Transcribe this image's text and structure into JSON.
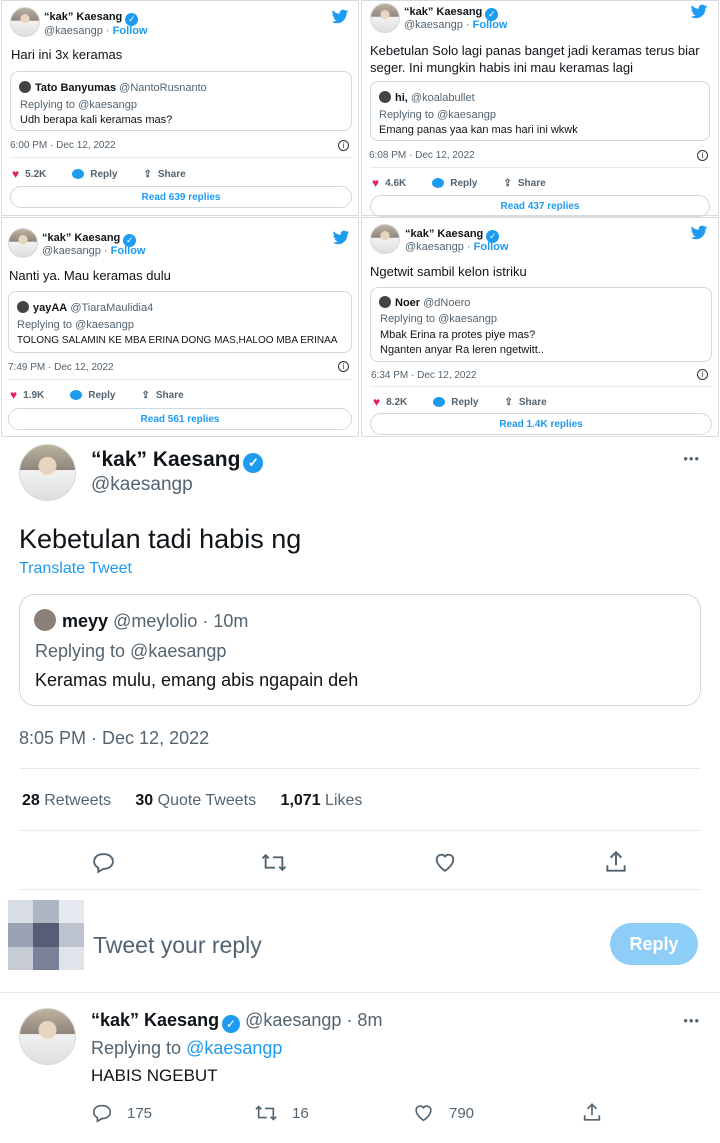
{
  "user": {
    "name": "“kak” Kaesang",
    "handle": "@kaesangp",
    "follow": "Follow"
  },
  "tweets": [
    {
      "text": "Hari ini 3x keramas",
      "quote_name": "Tato Banyumas",
      "quote_handle": "@NantoRusnanto",
      "replying": "Replying to @kaesangp",
      "quote_text": "Udh berapa kali keramas mas?",
      "time": "6:00 PM · Dec 12, 2022",
      "likes": "5.2K",
      "reply": "Reply",
      "share": "Share",
      "replies": "Read 639 replies"
    },
    {
      "text": "Kebetulan Solo lagi panas banget jadi keramas terus biar seger. Ini mungkin habis ini mau keramas lagi",
      "quote_name": "hi,",
      "quote_handle": "@koalabullet",
      "replying": "Replying to @kaesangp",
      "quote_text": "Emang panas yaa kan mas hari ini wkwk",
      "time": "6:08 PM · Dec 12, 2022",
      "likes": "4.6K",
      "reply": "Reply",
      "share": "Share",
      "replies": "Read 437 replies"
    },
    {
      "text": "Nanti ya. Mau keramas dulu",
      "quote_name": "yayAA",
      "quote_handle": "@TiaraMaulidia4",
      "replying": "Replying to @kaesangp",
      "quote_text": "TOLONG SALAMIN KE MBA ERINA DONG MAS,HALOO MBA ERINAA",
      "time": "7:49 PM · Dec 12, 2022",
      "likes": "1.9K",
      "reply": "Reply",
      "share": "Share",
      "replies": "Read 561 replies"
    },
    {
      "text": "Ngetwit sambil kelon istriku",
      "quote_name": "Noer",
      "quote_handle": "@dNoero",
      "replying": "Replying to @kaesangp",
      "quote_text": "Mbak Erina ra protes piye mas?",
      "quote_text2": "Nganten anyar Ra leren ngetwitt..",
      "time": "6:34 PM · Dec 12, 2022",
      "likes": "8.2K",
      "reply": "Reply",
      "share": "Share",
      "replies": "Read 1.4K replies"
    }
  ],
  "main": {
    "text": "Kebetulan tadi habis ng",
    "translate": "Translate Tweet",
    "quote_name": "meyy",
    "quote_handle": "@meylolio · 10m",
    "replying": "Replying to @kaesangp",
    "quote_text": "Keramas mulu, emang abis ngapain deh",
    "time": "8:05 PM · Dec 12, 2022",
    "retweets": "28",
    "retweets_label": "Retweets",
    "quotes": "30",
    "quotes_label": "Quote Tweets",
    "likes": "1,071",
    "likes_label": "Likes",
    "reply_placeholder": "Tweet your reply",
    "reply_button": "Reply",
    "more": "•••"
  },
  "reply_tweet": {
    "handle_time": "@kaesangp · 8m",
    "replying_prefix": "Replying to",
    "replying_handle": "@kaesangp",
    "text": "HABIS NGEBUT",
    "replies": "175",
    "retweets": "16",
    "likes": "790"
  },
  "icons": [
    "twitter-bird-icon",
    "verified-icon",
    "heart-icon",
    "reply-icon",
    "share-icon",
    "info-icon",
    "retweet-icon",
    "more-icon"
  ],
  "colors": {
    "twitter_blue": "#1d9bf0",
    "heart_red": "#e0245e",
    "reply_button_disabled": "#8ecdf8"
  }
}
